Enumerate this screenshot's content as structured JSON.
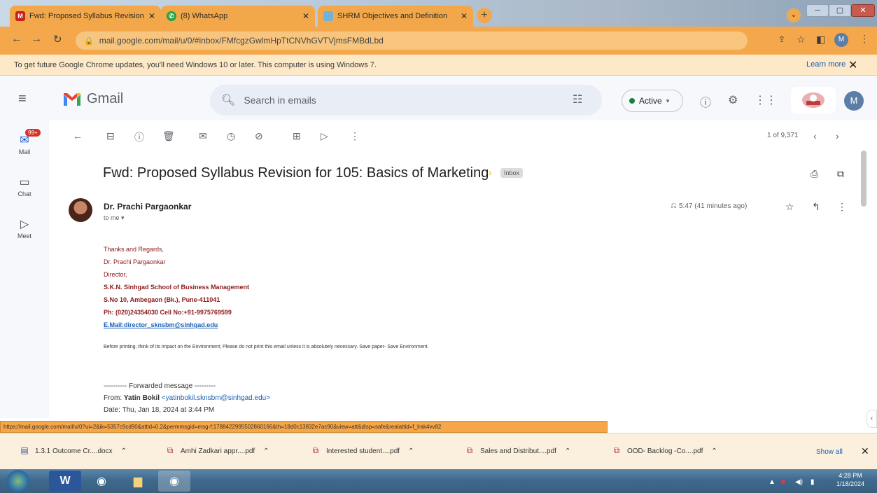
{
  "browser": {
    "tabs": [
      {
        "title": "Fwd: Proposed Syllabus Revision",
        "icon": "gmail-icon"
      },
      {
        "title": "(8) WhatsApp",
        "icon": "whatsapp-icon"
      },
      {
        "title": "SHRM Objectives and Definition",
        "icon": "page-icon"
      }
    ],
    "new_tab": "+",
    "url": "mail.google.com/mail/u/0/#inbox/FMfcgzGwlmHpTtCNVhGVTVjmsFMBdLbd",
    "info_message": "To get future Google Chrome updates, you'll need Windows 10 or later. This computer is using Windows 7.",
    "learn_more": "Learn more",
    "profile_initial": "M"
  },
  "gmail": {
    "brand": "Gmail",
    "search_placeholder": "Search in emails",
    "status": "Active",
    "account_initial": "M",
    "rail": {
      "mail_label": "Mail",
      "mail_badge": "99+",
      "chat_label": "Chat",
      "meet_label": "Meet"
    },
    "pagination": "1 of 9,371",
    "subject": "Fwd: Proposed Syllabus Revision for 105: Basics of Marketing",
    "label": "Inbox",
    "sender": "Dr. Prachi Pargaonkar",
    "to": "to me",
    "time": "5:47 (41 minutes ago)",
    "signature": [
      "Thanks and Regards,",
      "Dr. Prachi Pargaonkar",
      "Director,",
      "S.K.N. Sinhgad School of Business Management",
      "S.No 10, Ambegaon (Bk.), Pune-411041",
      "Ph: (020)24354030 Cell No:+91-9975769599",
      "E.Mail:director_sknsbm@sinhgad.edu"
    ],
    "disclaimer": "Before printing, think of its impact on the Environment; Please do not print this email unless it is absolutely necessary. Save paper- Save Environment.",
    "forwarded_header": "---------- Forwarded message ---------",
    "from_label": "From:",
    "from_name": "Yatin Bokil",
    "from_email": "<yatinbokil.sknsbm@sinhgad.edu>",
    "date_line": "Date: Thu, Jan 18, 2024 at 3:44 PM"
  },
  "status_url": "https://mail.google.com/mail/u/0?ui=2&ik=5357c9cd90&attid=0.2&permmsgid=msg-f:1788422995502860166&th=18d0c13832e7ac90&view=att&disp=safe&realattid=f_lrak4vv82",
  "downloads": {
    "items": [
      {
        "name": "1.3.1 Outcome Cr....docx"
      },
      {
        "name": "Amhi Zadkari appr....pdf"
      },
      {
        "name": "Interested student....pdf"
      },
      {
        "name": "Sales and Distribut....pdf"
      },
      {
        "name": "OOD- Backlog -Co....pdf"
      }
    ],
    "show_all": "Show all"
  },
  "taskbar": {
    "time": "4:28 PM",
    "date": "1/18/2024"
  }
}
